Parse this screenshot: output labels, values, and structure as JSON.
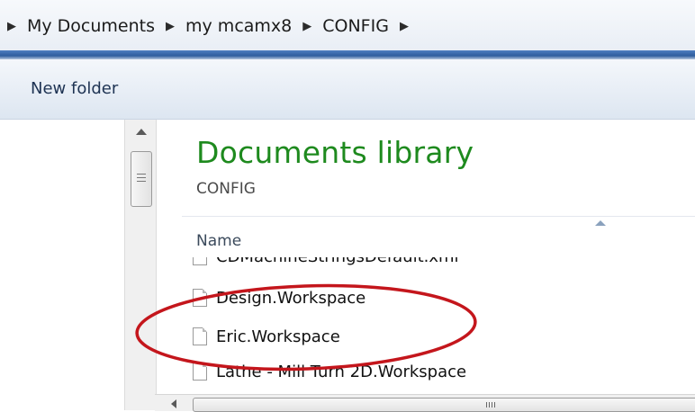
{
  "breadcrumb": {
    "items": [
      "My Documents",
      "my mcamx8",
      "CONFIG"
    ]
  },
  "toolbar": {
    "new_folder_label": "New folder"
  },
  "library": {
    "title": "Documents library",
    "subtitle": "CONFIG"
  },
  "file_list": {
    "column_header": "Name",
    "sorted": "ascending",
    "files": [
      {
        "name": "CDMachineStringsDefault.xml"
      },
      {
        "name": "Design.Workspace"
      },
      {
        "name": "Eric.Workspace"
      },
      {
        "name": "Lathe - Mill Turn 2D.Workspace"
      }
    ]
  },
  "scrollbar": {
    "grip_text": "|||"
  },
  "annotation": {
    "color": "#c4161c",
    "highlights": [
      "Design.Workspace",
      "Eric.Workspace"
    ]
  }
}
